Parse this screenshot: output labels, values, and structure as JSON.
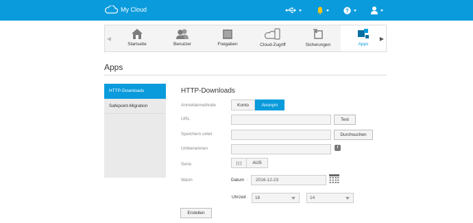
{
  "app": {
    "title": "My Cloud"
  },
  "nav": {
    "items": [
      {
        "label": "Startseite",
        "icon": "home-icon"
      },
      {
        "label": "Benutzer",
        "icon": "users-icon"
      },
      {
        "label": "Freigaben",
        "icon": "folder-icon"
      },
      {
        "label": "Cloud-Zugriff",
        "icon": "cloud-device-icon"
      },
      {
        "label": "Sicherungen",
        "icon": "backup-icon"
      },
      {
        "label": "Apps",
        "icon": "apps-icon"
      }
    ],
    "active": "Apps"
  },
  "page": {
    "title": "Apps"
  },
  "sidebar": {
    "items": [
      {
        "label": "HTTP-Downloads"
      },
      {
        "label": "Safepoint-Migration"
      }
    ]
  },
  "form": {
    "title": "HTTP-Downloads",
    "login_label": "Anmeldemethode",
    "login_options": [
      "Konto",
      "Anonym"
    ],
    "login_selected": "Anonym",
    "url_label": "URL",
    "url_value": "",
    "test_button": "Test",
    "save_to_label": "Speichern unter",
    "save_to_value": "",
    "browse_button": "Durchsuchen",
    "rename_label": "Umbenennen",
    "rename_value": "",
    "series_label": "Serie",
    "series_state": "AUS",
    "when_label": "Wann",
    "date_label": "Datum",
    "date_sep": ":",
    "date_value": "2016-12-23",
    "time_label": "Uhrzeit",
    "time_sep": ":",
    "hour_value": "16",
    "minute_value": "14",
    "create_button": "Erstellen"
  },
  "colors": {
    "accent": "#0a9bdc",
    "topbar": "#0a9bdc"
  }
}
